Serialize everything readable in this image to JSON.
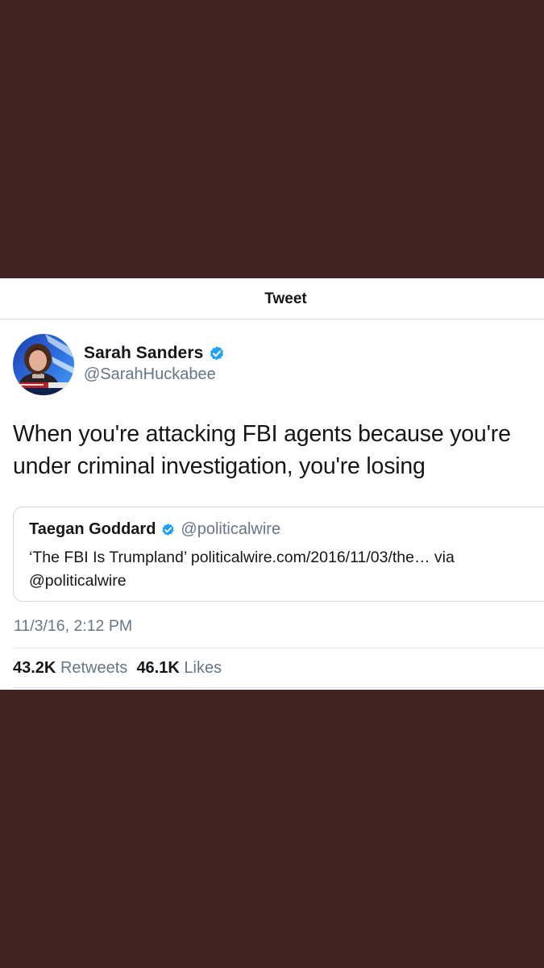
{
  "colors": {
    "background": "#412321",
    "card": "#ffffff",
    "text_primary": "#14171a",
    "text_secondary": "#657786",
    "verified_badge": "#1da1f2",
    "border": "#ccd6dd"
  },
  "nav": {
    "title": "Tweet"
  },
  "author": {
    "name": "Sarah Sanders",
    "handle": "@SarahHuckabee",
    "verified": true,
    "avatar_icon": "profile-photo"
  },
  "tweet": {
    "text": "When you're attacking FBI agents because you're under criminal investigation, you're losing",
    "timestamp": "11/3/16, 2:12 PM"
  },
  "quoted_tweet": {
    "name": "Taegan Goddard",
    "handle": "@politicalwire",
    "verified": true,
    "text": "‘The FBI Is Trumpland’ politicalwire.com/2016/11/03/the… via @politicalwire"
  },
  "stats": {
    "retweets_count": "43.2K",
    "retweets_label": "Retweets",
    "likes_count": "46.1K",
    "likes_label": "Likes"
  }
}
